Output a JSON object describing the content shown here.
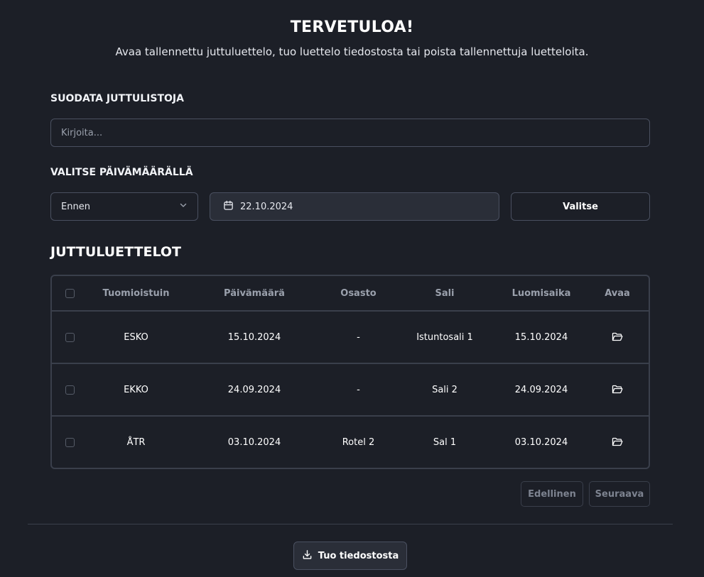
{
  "header": {
    "title": "TERVETULOA!",
    "subtitle": "Avaa tallennettu juttuluettelo, tuo luettelo tiedostosta tai poista tallennettuja luetteloita."
  },
  "filter": {
    "label": "SUODATA JUTTULISTOJA",
    "placeholder": "Kirjoita..."
  },
  "date_select": {
    "label": "VALITSE PÄIVÄMÄÄRÄLLÄ",
    "mode_value": "Ennen",
    "date_value": "22.10.2024",
    "button_label": "Valitse"
  },
  "lists": {
    "title": "JUTTULUETTELOT",
    "columns": [
      "Tuomioistuin",
      "Päivämäärä",
      "Osasto",
      "Sali",
      "Luomisaika",
      "Avaa"
    ],
    "rows": [
      {
        "court": "ESKO",
        "date": "15.10.2024",
        "department": "-",
        "room": "Istuntosali 1",
        "created": "15.10.2024"
      },
      {
        "court": "EKKO",
        "date": "24.09.2024",
        "department": "-",
        "room": "Sali 2",
        "created": "24.09.2024"
      },
      {
        "court": "ÅTR",
        "date": "03.10.2024",
        "department": "Rotel 2",
        "room": "Sal 1",
        "created": "03.10.2024"
      }
    ]
  },
  "pagination": {
    "previous_label": "Edellinen",
    "next_label": "Seuraava"
  },
  "import": {
    "button_label": "Tuo tiedostosta",
    "icon": "download-icon"
  },
  "colors": {
    "background": "#1c1f27",
    "border": "#3a3f4b",
    "field_fill": "#2a2e38"
  }
}
